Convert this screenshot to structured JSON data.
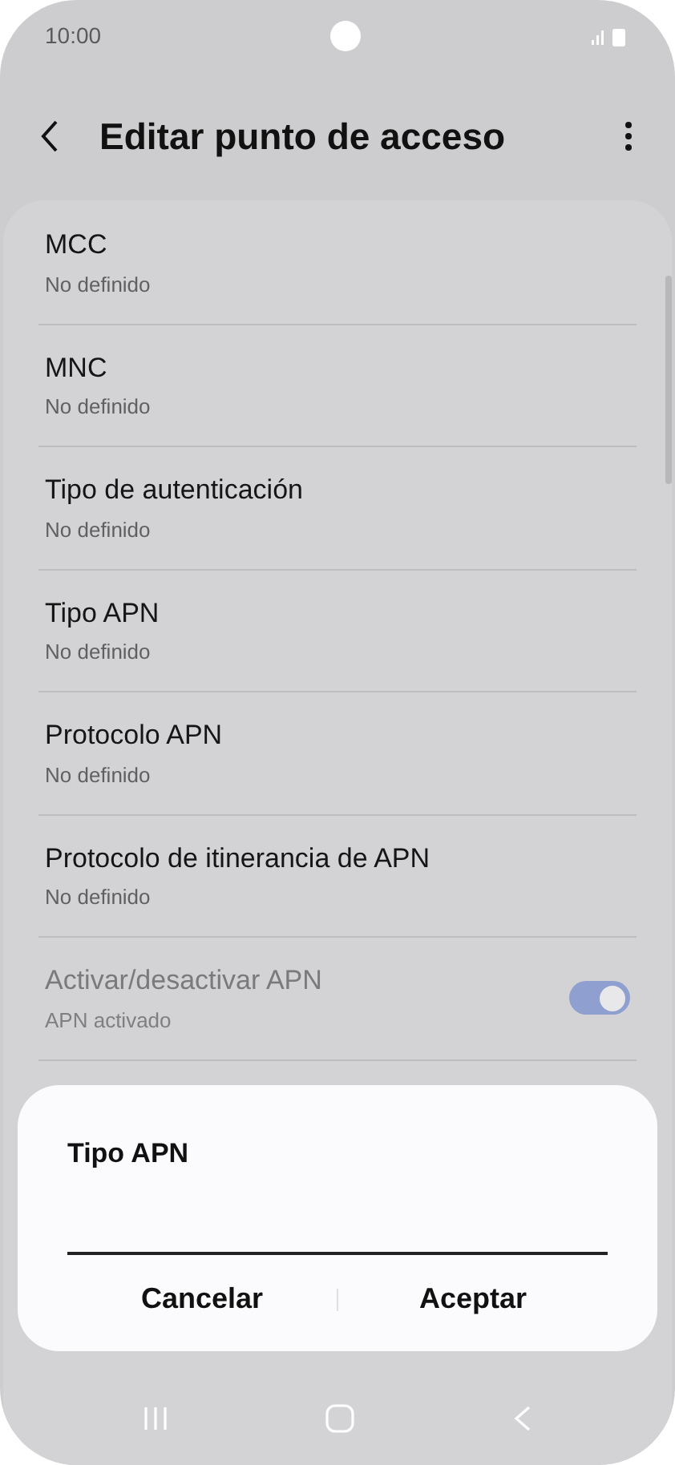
{
  "status_bar": {
    "time": "10:00"
  },
  "header": {
    "title": "Editar punto de acceso"
  },
  "rows": [
    {
      "kind": "text",
      "title": "MCC",
      "subtitle": "No definido",
      "disabled": false
    },
    {
      "kind": "text",
      "title": "MNC",
      "subtitle": "No definido",
      "disabled": false
    },
    {
      "kind": "text",
      "title": "Tipo de autenticación",
      "subtitle": "No definido",
      "disabled": false
    },
    {
      "kind": "text",
      "title": "Tipo APN",
      "subtitle": "No definido",
      "disabled": false
    },
    {
      "kind": "text",
      "title": "Protocolo APN",
      "subtitle": "No definido",
      "disabled": false
    },
    {
      "kind": "text",
      "title": "Protocolo de itinerancia de APN",
      "subtitle": "No definido",
      "disabled": false
    },
    {
      "kind": "toggle",
      "title": "Activar/desactivar APN",
      "subtitle": "APN activado",
      "disabled": true,
      "on": true
    }
  ],
  "dialog": {
    "title": "Tipo APN",
    "buttons": [
      "Cancelar",
      "Aceptar"
    ]
  }
}
